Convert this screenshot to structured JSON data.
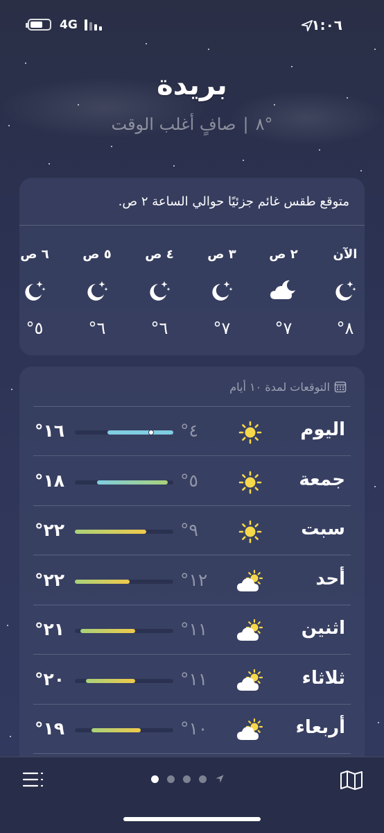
{
  "status_bar": {
    "network": "4G",
    "time": "١:٠٦",
    "battery_level": 0.65
  },
  "header": {
    "city": "بريدة",
    "temperature": "°٨",
    "condition": "صافٍ أغلب الوقت"
  },
  "hourly": {
    "summary": "متوقع طقس غائم جزئيًا حوالي الساعة ٢ ص.",
    "items": [
      {
        "label": "الآن",
        "icon": "moon-stars-icon",
        "temp": "°٨"
      },
      {
        "label": "٢ ص",
        "icon": "cloud-moon-icon",
        "temp": "°٧"
      },
      {
        "label": "٣ ص",
        "icon": "moon-stars-icon",
        "temp": "°٧"
      },
      {
        "label": "٤ ص",
        "icon": "moon-stars-icon",
        "temp": "°٦"
      },
      {
        "label": "٥ ص",
        "icon": "moon-stars-icon",
        "temp": "°٦"
      },
      {
        "label": "٦ ص",
        "icon": "moon-stars-icon",
        "temp": "°٥"
      }
    ]
  },
  "forecast": {
    "header": "التوقعات لمدة ١٠ أيام",
    "range_min": 4,
    "range_max": 22,
    "days": [
      {
        "day": "اليوم",
        "icon": "sun-icon",
        "low": "°٤",
        "high": "°١٦",
        "low_val": 4,
        "high_val": 16,
        "current": 8
      },
      {
        "day": "جمعة",
        "icon": "sun-icon",
        "low": "°٥",
        "high": "°١٨",
        "low_val": 5,
        "high_val": 18
      },
      {
        "day": "سبت",
        "icon": "sun-icon",
        "low": "°٩",
        "high": "°٢٢",
        "low_val": 9,
        "high_val": 22
      },
      {
        "day": "أحد",
        "icon": "cloud-sun-icon",
        "low": "°١٢",
        "high": "°٢٢",
        "low_val": 12,
        "high_val": 22
      },
      {
        "day": "اثنين",
        "icon": "cloud-sun-icon",
        "low": "°١١",
        "high": "°٢١",
        "low_val": 11,
        "high_val": 21
      },
      {
        "day": "ثلاثاء",
        "icon": "cloud-sun-icon",
        "low": "°١١",
        "high": "°٢٠",
        "low_val": 11,
        "high_val": 20
      },
      {
        "day": "أربعاء",
        "icon": "cloud-sun-icon",
        "low": "°١٠",
        "high": "°١٩",
        "low_val": 10,
        "high_val": 19
      }
    ]
  },
  "bottom_bar": {
    "page_count": 4,
    "active_page": 0
  },
  "colors": {
    "sun": "#f7d84a",
    "cool": "#7fcde0",
    "mild": "#a8d27a",
    "warm": "#f0c94a"
  }
}
